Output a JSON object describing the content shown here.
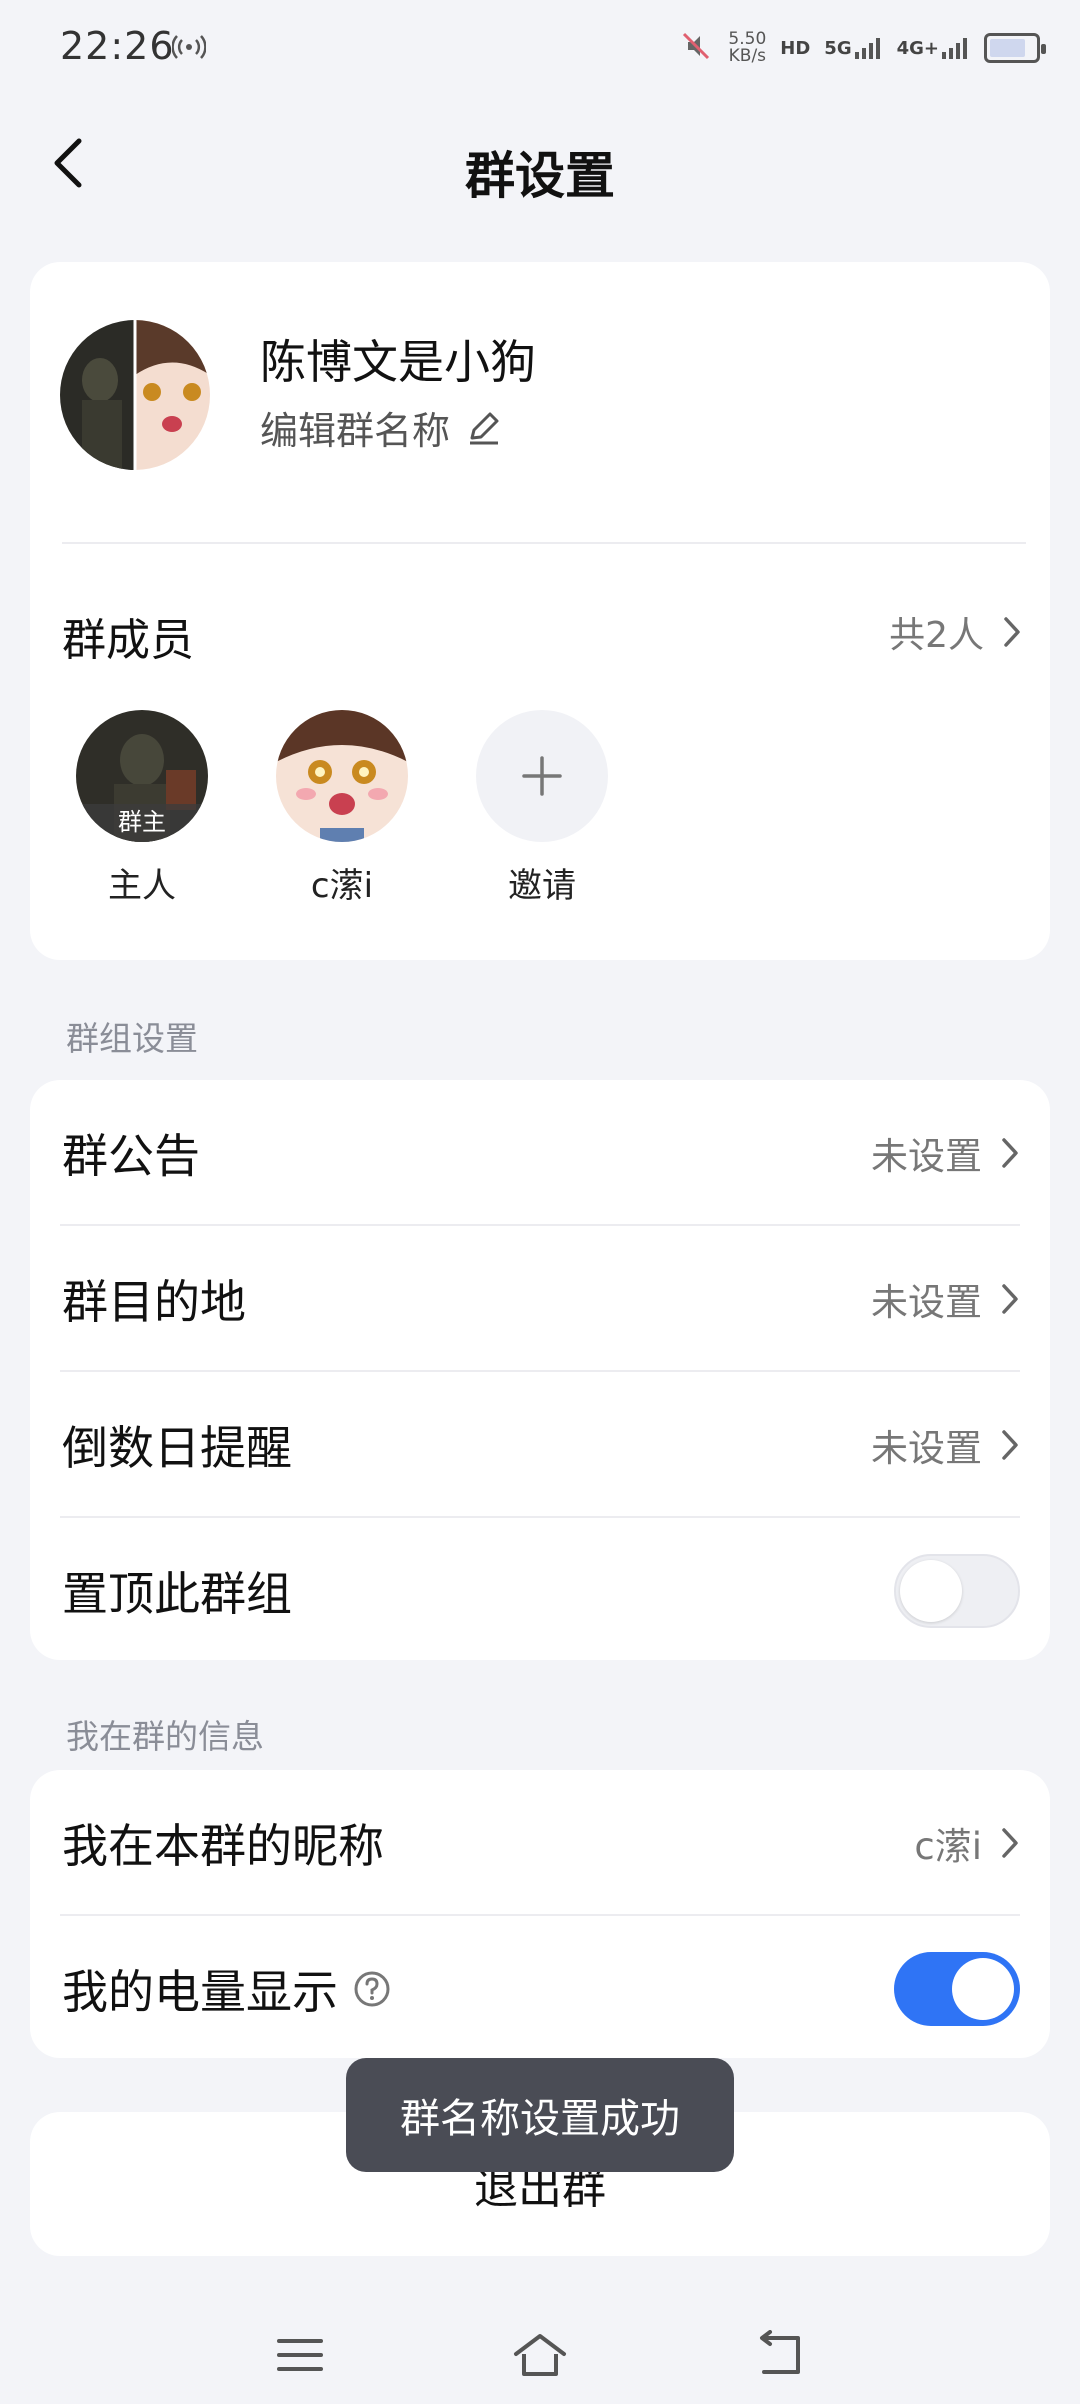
{
  "status_bar": {
    "time": "22:26",
    "net_speed_value": "5.50",
    "net_speed_unit": "KB/s",
    "hd_label": "HD",
    "sim1_label": "5G",
    "sim2_label": "4G+"
  },
  "header": {
    "title": "群设置"
  },
  "group": {
    "name": "陈博文是小狗",
    "edit_label": "编辑群名称"
  },
  "members": {
    "title": "群成员",
    "count_text": "共2人",
    "list": [
      {
        "name": "主人",
        "badge": "群主"
      },
      {
        "name": "c潆i"
      }
    ],
    "invite_label": "邀请"
  },
  "group_settings": {
    "section_label": "群组设置",
    "rows": [
      {
        "label": "群公告",
        "value": "未设置"
      },
      {
        "label": "群目的地",
        "value": "未设置"
      },
      {
        "label": "倒数日提醒",
        "value": "未设置"
      }
    ],
    "pin_label": "置顶此群组",
    "pin_enabled": false
  },
  "my_info": {
    "section_label": "我在群的信息",
    "nickname_label": "我在本群的昵称",
    "nickname_value": "c潆i",
    "battery_label": "我的电量显示",
    "battery_enabled": true
  },
  "exit": {
    "label": "退出群"
  },
  "toast": {
    "message": "群名称设置成功"
  },
  "colors": {
    "accent": "#2f74f5",
    "background": "#f3f4f8",
    "toast_bg": "#4a4c55"
  }
}
